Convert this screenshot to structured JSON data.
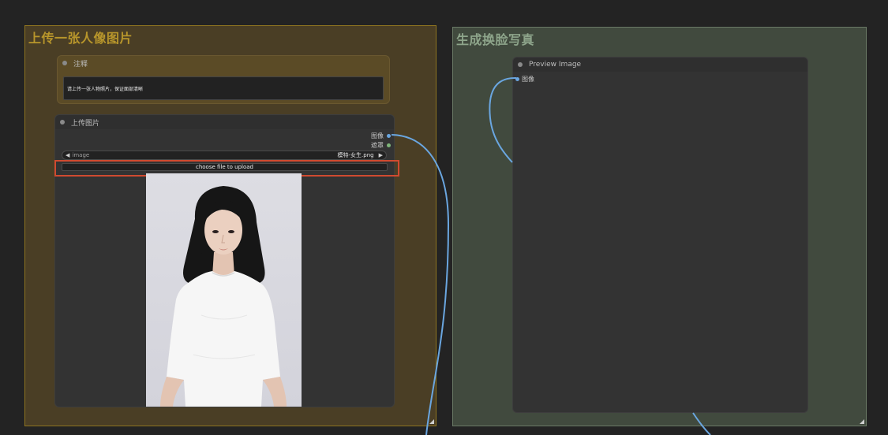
{
  "groups": {
    "upload_group_title": "上传一张人像图片",
    "result_group_title": "生成换脸写真"
  },
  "note_node": {
    "title": "注释",
    "text": "请上传一张人物照片，保证面部清晰"
  },
  "load_image_node": {
    "title": "上传图片",
    "outputs": [
      "图像",
      "遮罩"
    ],
    "image_widget": {
      "name": "image",
      "value": "模特-女生.png"
    },
    "upload_button": "choose file to upload"
  },
  "preview_node": {
    "title": "Preview Image",
    "input_label": "图像"
  },
  "colors": {
    "canvas_bg": "#232323",
    "yellow_group": "#4a3e25",
    "green_group": "#414a3e",
    "link_blue": "#6aa6e0",
    "highlight_red": "#d04a30"
  }
}
